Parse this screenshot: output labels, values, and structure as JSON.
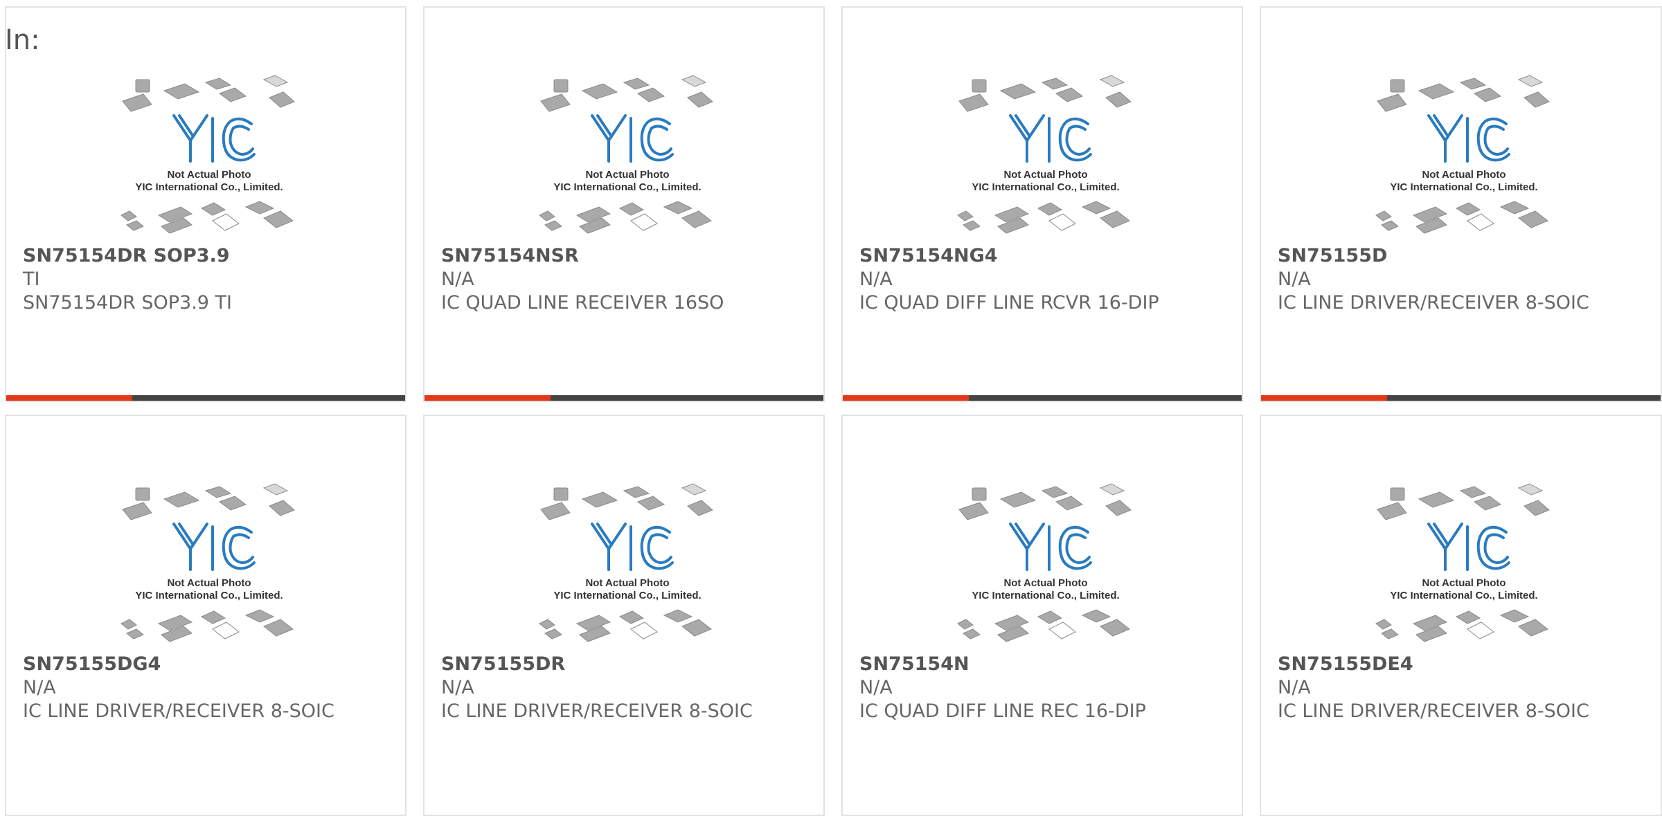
{
  "page": {
    "label": "In:"
  },
  "thumbnail": {
    "brand": "YIC",
    "caption_line1": "Not Actual Photo",
    "caption_line2": "YIC International Co., Limited.",
    "brand_color": "#2a7bbf"
  },
  "accent_color": "#e2391a",
  "cards": [
    {
      "part": "SN75154DR SOP3.9",
      "brand": "TI",
      "desc": "SN75154DR SOP3.9 TI"
    },
    {
      "part": "SN75154NSR",
      "brand": "N/A",
      "desc": "IC QUAD LINE RECEIVER 16SO"
    },
    {
      "part": "SN75154NG4",
      "brand": "N/A",
      "desc": "IC QUAD DIFF LINE RCVR 16-DIP"
    },
    {
      "part": "SN75155D",
      "brand": "N/A",
      "desc": "IC LINE DRIVER/RECEIVER 8-SOIC"
    },
    {
      "part": "SN75155DG4",
      "brand": "N/A",
      "desc": "IC LINE DRIVER/RECEIVER 8-SOIC"
    },
    {
      "part": "SN75155DR",
      "brand": "N/A",
      "desc": "IC LINE DRIVER/RECEIVER 8-SOIC"
    },
    {
      "part": "SN75154N",
      "brand": "N/A",
      "desc": "IC QUAD DIFF LINE REC 16-DIP"
    },
    {
      "part": "SN75155DE4",
      "brand": "N/A",
      "desc": "IC LINE DRIVER/RECEIVER 8-SOIC"
    }
  ]
}
